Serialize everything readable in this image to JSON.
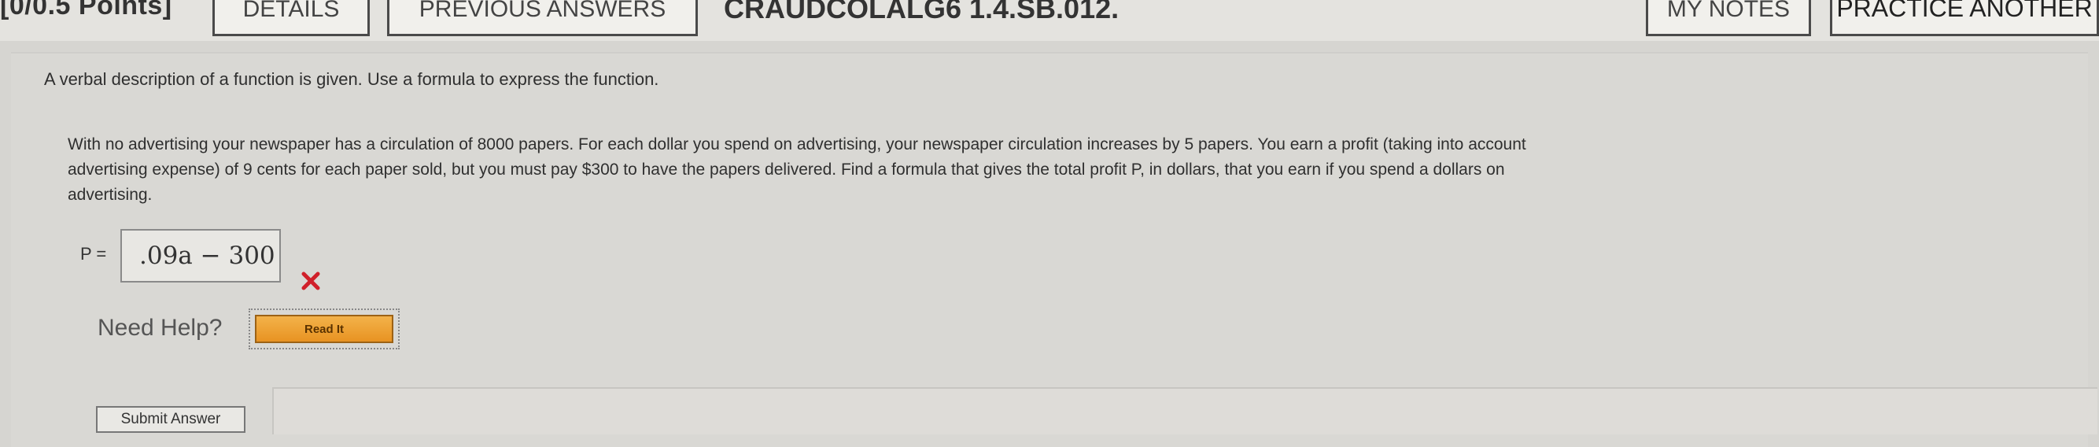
{
  "toolbar": {
    "points": "[0/0.5 Points]",
    "details_label": "DETAILS",
    "previous_answers_label": "PREVIOUS ANSWERS",
    "question_id": "CRAUDCOLALG6 1.4.SB.012.",
    "my_notes_label": "MY NOTES",
    "practice_another_label": "PRACTICE ANOTHER"
  },
  "question": {
    "intro": "A verbal description of a function is given. Use a formula to express the function.",
    "problem_lines": [
      "With no advertising your newspaper has a circulation of 8000 papers. For each dollar you spend on advertising, your newspaper circulation increases by 5 papers. You earn a profit (taking into account",
      "advertising expense) of 9 cents for each paper sold, but you must pay $300 to have the papers delivered. Find a formula that gives the total profit P, in dollars, that you earn if you spend a dollars on",
      "advertising."
    ],
    "answer_label": "P =",
    "answer_value": ".09a − 300",
    "answer_status": "incorrect",
    "answer_status_color": "#d0202a"
  },
  "help": {
    "label": "Need Help?",
    "read_it_label": "Read It"
  },
  "actions": {
    "submit_label": "Submit Answer"
  }
}
